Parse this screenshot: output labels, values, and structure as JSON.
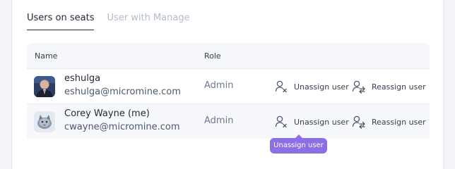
{
  "tabs": [
    {
      "label": "Users on seats",
      "active": true
    },
    {
      "label": "User with Manage",
      "active": false
    }
  ],
  "table": {
    "headers": {
      "name": "Name",
      "role": "Role"
    },
    "rows": [
      {
        "name": "eshulga",
        "email": "eshulga@micromine.com",
        "role": "Admin",
        "avatar": "photo-avatar",
        "unassign_label": "Unassign user",
        "reassign_label": "Reassign user"
      },
      {
        "name": "Corey Wayne (me)",
        "email": "cwayne@micromine.com",
        "role": "Admin",
        "avatar": "cat-avatar",
        "unassign_label": "Unassign user",
        "reassign_label": "Reassign user"
      }
    ]
  },
  "tooltip": {
    "text": "Unassign user"
  },
  "colors": {
    "accent": "#8b6fe3",
    "header_bg": "#f4f6f9",
    "inactive_tab": "#b3bcc9"
  }
}
